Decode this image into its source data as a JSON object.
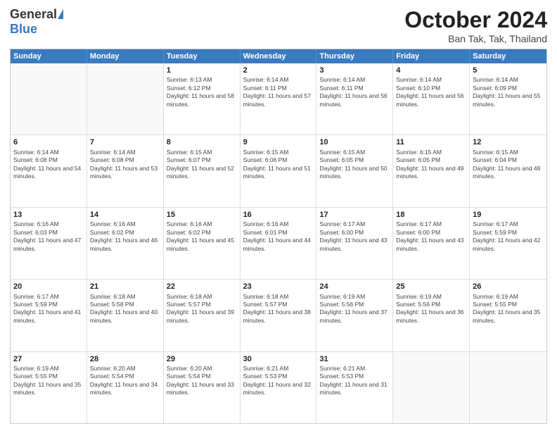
{
  "logo": {
    "general": "General",
    "blue": "Blue"
  },
  "title": "October 2024",
  "subtitle": "Ban Tak, Tak, Thailand",
  "headers": [
    "Sunday",
    "Monday",
    "Tuesday",
    "Wednesday",
    "Thursday",
    "Friday",
    "Saturday"
  ],
  "weeks": [
    [
      {
        "day": "",
        "info": ""
      },
      {
        "day": "",
        "info": ""
      },
      {
        "day": "1",
        "info": "Sunrise: 6:13 AM\nSunset: 6:12 PM\nDaylight: 11 hours and 58 minutes."
      },
      {
        "day": "2",
        "info": "Sunrise: 6:14 AM\nSunset: 6:11 PM\nDaylight: 11 hours and 57 minutes."
      },
      {
        "day": "3",
        "info": "Sunrise: 6:14 AM\nSunset: 6:11 PM\nDaylight: 11 hours and 56 minutes."
      },
      {
        "day": "4",
        "info": "Sunrise: 6:14 AM\nSunset: 6:10 PM\nDaylight: 11 hours and 56 minutes."
      },
      {
        "day": "5",
        "info": "Sunrise: 6:14 AM\nSunset: 6:09 PM\nDaylight: 11 hours and 55 minutes."
      }
    ],
    [
      {
        "day": "6",
        "info": "Sunrise: 6:14 AM\nSunset: 6:08 PM\nDaylight: 11 hours and 54 minutes."
      },
      {
        "day": "7",
        "info": "Sunrise: 6:14 AM\nSunset: 6:08 PM\nDaylight: 11 hours and 53 minutes."
      },
      {
        "day": "8",
        "info": "Sunrise: 6:15 AM\nSunset: 6:07 PM\nDaylight: 11 hours and 52 minutes."
      },
      {
        "day": "9",
        "info": "Sunrise: 6:15 AM\nSunset: 6:06 PM\nDaylight: 11 hours and 51 minutes."
      },
      {
        "day": "10",
        "info": "Sunrise: 6:15 AM\nSunset: 6:05 PM\nDaylight: 11 hours and 50 minutes."
      },
      {
        "day": "11",
        "info": "Sunrise: 6:15 AM\nSunset: 6:05 PM\nDaylight: 11 hours and 49 minutes."
      },
      {
        "day": "12",
        "info": "Sunrise: 6:15 AM\nSunset: 6:04 PM\nDaylight: 11 hours and 48 minutes."
      }
    ],
    [
      {
        "day": "13",
        "info": "Sunrise: 6:16 AM\nSunset: 6:03 PM\nDaylight: 11 hours and 47 minutes."
      },
      {
        "day": "14",
        "info": "Sunrise: 6:16 AM\nSunset: 6:02 PM\nDaylight: 11 hours and 46 minutes."
      },
      {
        "day": "15",
        "info": "Sunrise: 6:16 AM\nSunset: 6:02 PM\nDaylight: 11 hours and 45 minutes."
      },
      {
        "day": "16",
        "info": "Sunrise: 6:16 AM\nSunset: 6:01 PM\nDaylight: 11 hours and 44 minutes."
      },
      {
        "day": "17",
        "info": "Sunrise: 6:17 AM\nSunset: 6:00 PM\nDaylight: 11 hours and 43 minutes."
      },
      {
        "day": "18",
        "info": "Sunrise: 6:17 AM\nSunset: 6:00 PM\nDaylight: 11 hours and 43 minutes."
      },
      {
        "day": "19",
        "info": "Sunrise: 6:17 AM\nSunset: 5:59 PM\nDaylight: 11 hours and 42 minutes."
      }
    ],
    [
      {
        "day": "20",
        "info": "Sunrise: 6:17 AM\nSunset: 5:59 PM\nDaylight: 11 hours and 41 minutes."
      },
      {
        "day": "21",
        "info": "Sunrise: 6:18 AM\nSunset: 5:58 PM\nDaylight: 11 hours and 40 minutes."
      },
      {
        "day": "22",
        "info": "Sunrise: 6:18 AM\nSunset: 5:57 PM\nDaylight: 11 hours and 39 minutes."
      },
      {
        "day": "23",
        "info": "Sunrise: 6:18 AM\nSunset: 5:57 PM\nDaylight: 11 hours and 38 minutes."
      },
      {
        "day": "24",
        "info": "Sunrise: 6:19 AM\nSunset: 5:56 PM\nDaylight: 11 hours and 37 minutes."
      },
      {
        "day": "25",
        "info": "Sunrise: 6:19 AM\nSunset: 5:56 PM\nDaylight: 11 hours and 36 minutes."
      },
      {
        "day": "26",
        "info": "Sunrise: 6:19 AM\nSunset: 5:55 PM\nDaylight: 11 hours and 35 minutes."
      }
    ],
    [
      {
        "day": "27",
        "info": "Sunrise: 6:19 AM\nSunset: 5:55 PM\nDaylight: 11 hours and 35 minutes."
      },
      {
        "day": "28",
        "info": "Sunrise: 6:20 AM\nSunset: 5:54 PM\nDaylight: 11 hours and 34 minutes."
      },
      {
        "day": "29",
        "info": "Sunrise: 6:20 AM\nSunset: 5:54 PM\nDaylight: 11 hours and 33 minutes."
      },
      {
        "day": "30",
        "info": "Sunrise: 6:21 AM\nSunset: 5:53 PM\nDaylight: 11 hours and 32 minutes."
      },
      {
        "day": "31",
        "info": "Sunrise: 6:21 AM\nSunset: 5:53 PM\nDaylight: 11 hours and 31 minutes."
      },
      {
        "day": "",
        "info": ""
      },
      {
        "day": "",
        "info": ""
      }
    ]
  ]
}
